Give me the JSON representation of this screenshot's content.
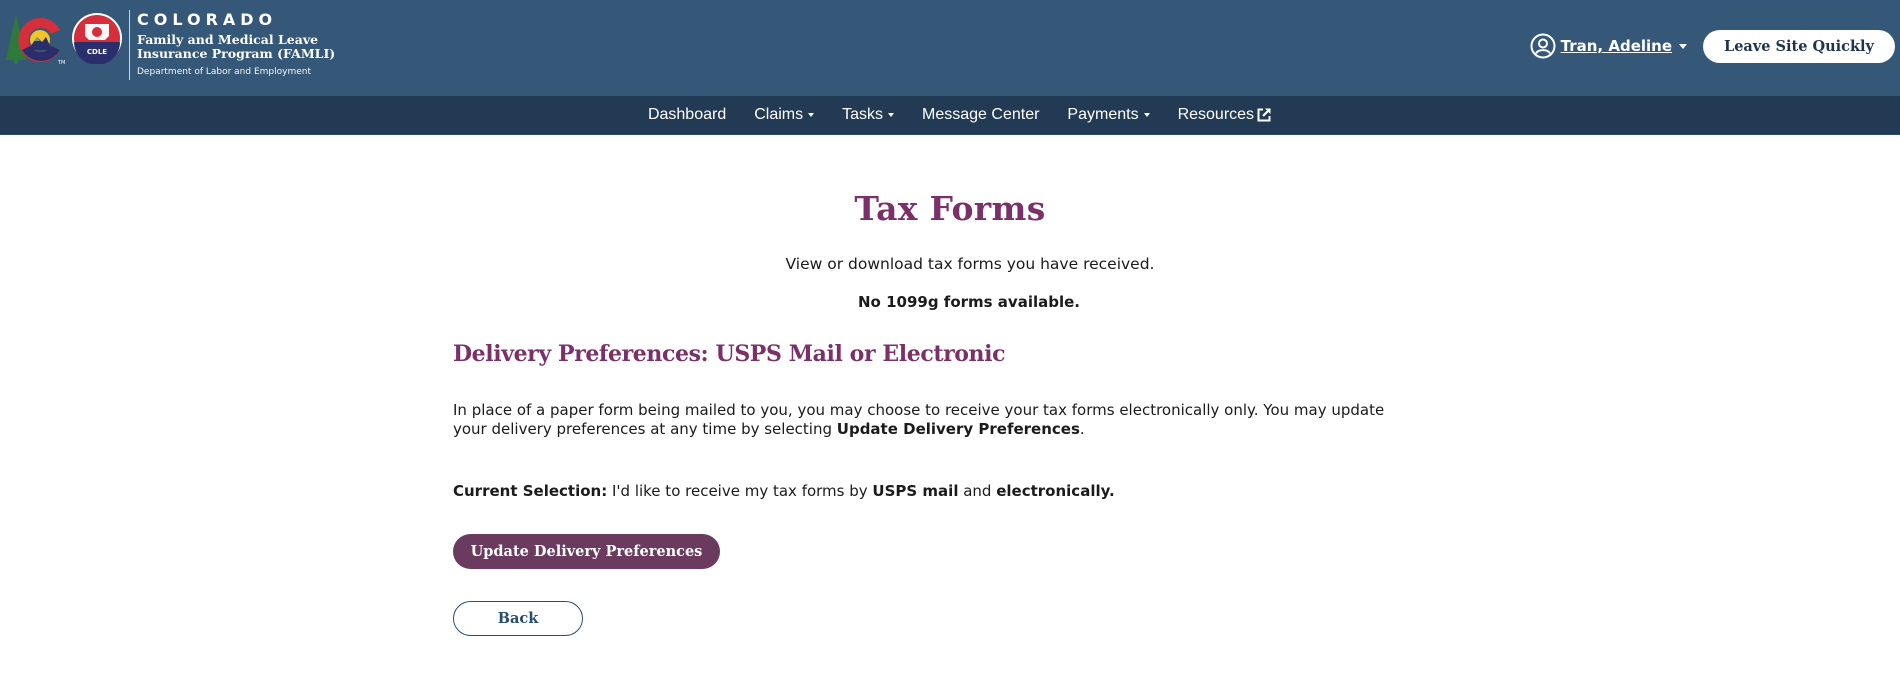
{
  "header": {
    "logo": {
      "state": "COLORADO",
      "program_line1": "Family and Medical Leave",
      "program_line2": "Insurance Program (FAMLI)",
      "department": "Department of Labor and Employment",
      "seal_label": "CDLE"
    },
    "user": {
      "name": "Tran, Adeline",
      "icon": "user-circle-icon"
    },
    "leave_button": "Leave Site Quickly",
    "colors": {
      "top_bar": "#355778",
      "nav_bar": "#223a53"
    }
  },
  "nav": {
    "items": [
      {
        "label": "Dashboard",
        "dropdown": false
      },
      {
        "label": "Claims",
        "dropdown": true
      },
      {
        "label": "Tasks",
        "dropdown": true
      },
      {
        "label": "Message Center",
        "dropdown": false
      },
      {
        "label": "Payments",
        "dropdown": true
      },
      {
        "label": "Resources",
        "dropdown": false,
        "icon": "external-link-icon"
      }
    ]
  },
  "main": {
    "title": "Tax Forms",
    "subtitle": "View or download tax forms you have received.",
    "no_forms": "No 1099g forms available.",
    "section_heading": "Delivery Preferences: USPS Mail or Electronic",
    "description": {
      "text1": "In place of a paper form being mailed to you, you may choose to receive your tax forms electronically only. You may update your delivery preferences at any time by selecting ",
      "bold": "Update Delivery Preferences",
      "text2": "."
    },
    "current_selection": {
      "label": "Current Selection:",
      "text1": " I'd like to receive my tax forms by ",
      "bold1": "USPS mail",
      "text2": " and ",
      "bold2": "electronically."
    },
    "update_button": "Update Delivery Preferences",
    "back_button": "Back",
    "colors": {
      "heading": "#7a3068",
      "primary_button": "#6a3a5f",
      "secondary_button_border": "#2a4d72"
    }
  }
}
